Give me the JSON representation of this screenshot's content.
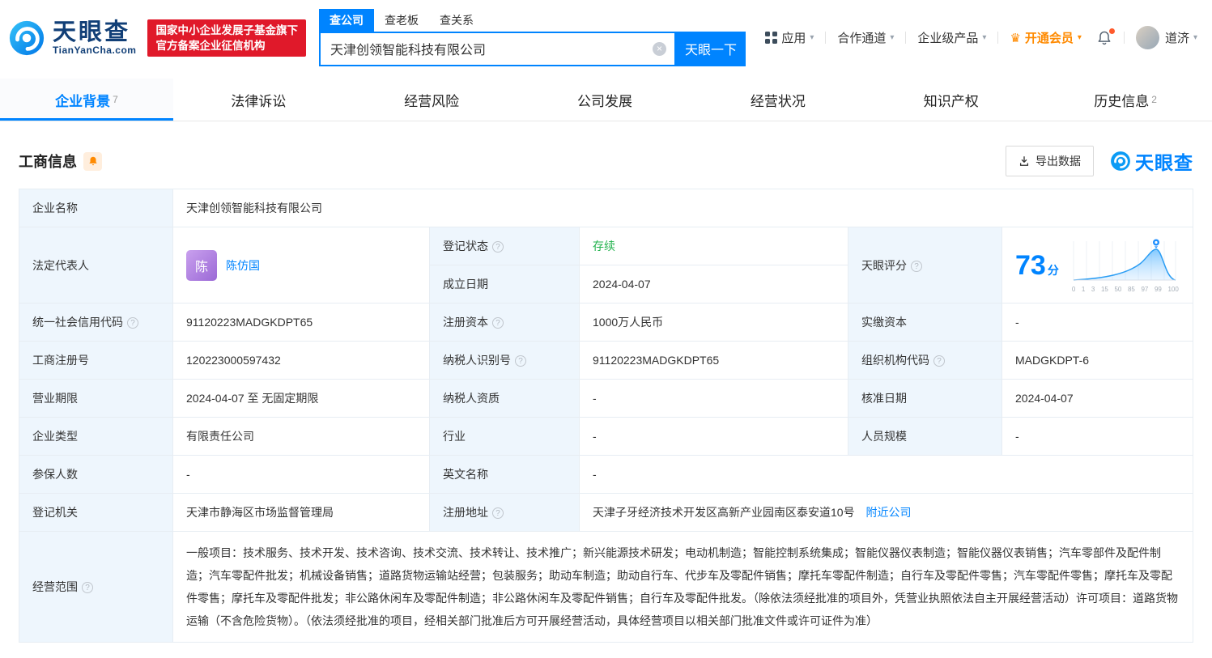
{
  "brand": {
    "logo_cn": "天眼查",
    "logo_en": "TianYanCha.com",
    "badge_line1": "国家中小企业发展子基金旗下",
    "badge_line2": "官方备案企业征信机构"
  },
  "search": {
    "tabs": [
      {
        "label": "查公司"
      },
      {
        "label": "查老板"
      },
      {
        "label": "查关系"
      }
    ],
    "value": "天津创领智能科技有限公司",
    "button": "天眼一下"
  },
  "topnav": {
    "apps": "应用",
    "cooperation": "合作通道",
    "enterprise": "企业级产品",
    "vip": "开通会员",
    "user": "道济"
  },
  "icons": {
    "help": "?",
    "clear": "×",
    "caret": "▾",
    "crown": "♛"
  },
  "tabs": [
    {
      "label": "企业背景",
      "count": "7"
    },
    {
      "label": "法律诉讼",
      "count": ""
    },
    {
      "label": "经营风险",
      "count": ""
    },
    {
      "label": "公司发展",
      "count": ""
    },
    {
      "label": "经营状况",
      "count": ""
    },
    {
      "label": "知识产权",
      "count": ""
    },
    {
      "label": "历史信息",
      "count": "2"
    }
  ],
  "section": {
    "title": "工商信息",
    "export": "导出数据",
    "watermark": "天眼查"
  },
  "info": {
    "company_name_label": "企业名称",
    "company_name": "天津创领智能科技有限公司",
    "legal_rep_label": "法定代表人",
    "legal_rep_avatar": "陈",
    "legal_rep_name": "陈仿国",
    "reg_status_label": "登记状态",
    "reg_status": "存续",
    "establish_date_label": "成立日期",
    "establish_date": "2024-04-07",
    "score_label": "天眼评分",
    "score_value": "73",
    "score_unit": "分",
    "credit_code_label": "统一社会信用代码",
    "credit_code": "91120223MADGKDPT65",
    "reg_capital_label": "注册资本",
    "reg_capital": "1000万人民币",
    "paid_capital_label": "实缴资本",
    "paid_capital": "-",
    "reg_number_label": "工商注册号",
    "reg_number": "120223000597432",
    "taxpayer_id_label": "纳税人识别号",
    "taxpayer_id": "91120223MADGKDPT65",
    "org_code_label": "组织机构代码",
    "org_code": "MADGKDPT-6",
    "business_term_label": "营业期限",
    "business_term": "2024-04-07 至 无固定期限",
    "taxpayer_quality_label": "纳税人资质",
    "taxpayer_quality": "-",
    "approval_date_label": "核准日期",
    "approval_date": "2024-04-07",
    "company_type_label": "企业类型",
    "company_type": "有限责任公司",
    "industry_label": "行业",
    "industry": "-",
    "staff_size_label": "人员规模",
    "staff_size": "-",
    "insured_label": "参保人数",
    "insured": "-",
    "english_name_label": "英文名称",
    "english_name": "-",
    "reg_authority_label": "登记机关",
    "reg_authority": "天津市静海区市场监督管理局",
    "address_label": "注册地址",
    "address": "天津子牙经济技术开发区高新产业园南区泰安道10号",
    "nearby_link": "附近公司",
    "scope_label": "经营范围",
    "scope": "一般项目：技术服务、技术开发、技术咨询、技术交流、技术转让、技术推广；新兴能源技术研发；电动机制造；智能控制系统集成；智能仪器仪表制造；智能仪器仪表销售；汽车零部件及配件制造；汽车零配件批发；机械设备销售；道路货物运输站经营；包装服务；助动车制造；助动自行车、代步车及零配件销售；摩托车零配件制造；自行车及零配件零售；汽车零配件零售；摩托车及零配件零售；摩托车及零配件批发；非公路休闲车及零配件制造；非公路休闲车及零配件销售；自行车及零配件批发。（除依法须经批准的项目外，凭营业执照依法自主开展经营活动）许可项目：道路货物运输（不含危险货物）。（依法须经批准的项目，经相关部门批准后方可开展经营活动，具体经营项目以相关部门批准文件或许可证件为准）"
  },
  "score_chart": {
    "type": "area",
    "score": 73,
    "ticks": [
      "0",
      "1",
      "3",
      "15",
      "50",
      "85",
      "97",
      "99",
      "100"
    ]
  },
  "colors": {
    "primary": "#0084ff",
    "status_green": "#21b24c",
    "vip_orange": "#ff8a00",
    "badge_red": "#e0192a",
    "label_bg": "#eef6fd"
  }
}
